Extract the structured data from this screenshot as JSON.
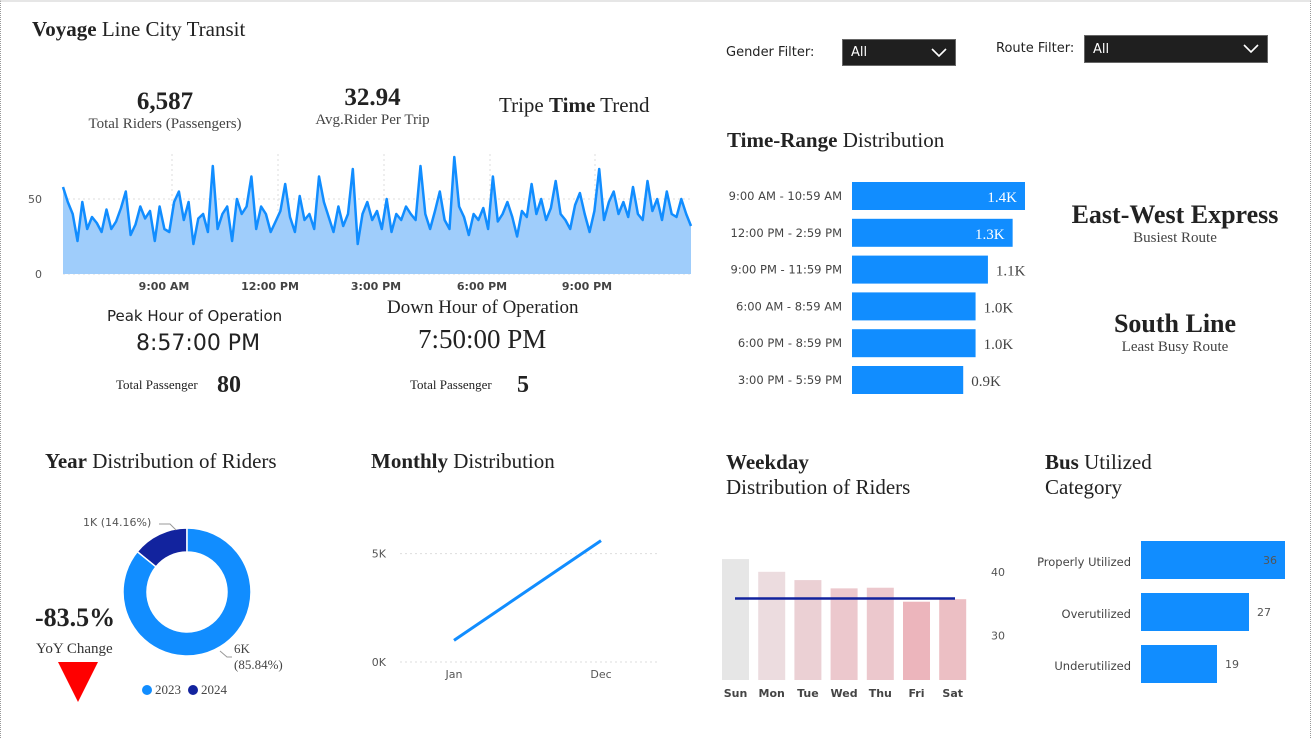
{
  "header": {
    "title_bold": "Voyage",
    "title_rest": " Line City Transit"
  },
  "filters": {
    "gender_label": "Gender Filter:",
    "gender_value": "All",
    "route_label": "Route Filter:",
    "route_value": "All"
  },
  "kpis": {
    "total_riders_value": "6,587",
    "total_riders_label": "Total Riders (Passengers)",
    "avg_rider_value": "32.94",
    "avg_rider_label": "Avg.Rider Per Trip"
  },
  "trend": {
    "title_a": "Tripe ",
    "title_b": "Time",
    "title_c": " Trend",
    "chart_data": {
      "type": "area",
      "title": "Tripe Time Trend",
      "x_ticks": [
        "9:00 AM",
        "12:00 PM",
        "3:00 PM",
        "6:00 PM",
        "9:00 PM"
      ],
      "y_ticks": [
        "0",
        "50"
      ],
      "ylim": [
        0,
        80
      ],
      "values": [
        58,
        48,
        40,
        22,
        48,
        30,
        38,
        34,
        28,
        43,
        30,
        35,
        44,
        55,
        26,
        33,
        45,
        37,
        42,
        22,
        45,
        30,
        28,
        48,
        55,
        36,
        48,
        20,
        37,
        40,
        28,
        72,
        30,
        40,
        45,
        22,
        50,
        40,
        45,
        65,
        30,
        45,
        40,
        28,
        35,
        42,
        60,
        38,
        28,
        52,
        36,
        40,
        30,
        65,
        48,
        38,
        28,
        45,
        32,
        40,
        70,
        20,
        40,
        48,
        36,
        42,
        30,
        50,
        28,
        40,
        36,
        45,
        40,
        36,
        72,
        40,
        30,
        42,
        55,
        36,
        30,
        78,
        45,
        38,
        26,
        40,
        36,
        44,
        30,
        65,
        35,
        40,
        48,
        38,
        25,
        42,
        38,
        60,
        40,
        50,
        36,
        44,
        62,
        40,
        36,
        30,
        46,
        54,
        40,
        28,
        42,
        70,
        36,
        48,
        55,
        40,
        48,
        38,
        58,
        40,
        36,
        62,
        42,
        50,
        36,
        55,
        40,
        38,
        50,
        40,
        32
      ]
    }
  },
  "peak": {
    "title": "Peak Hour of Operation",
    "time": "8:57:00 PM",
    "total_label": "Total Passenger",
    "total_value": "80"
  },
  "down": {
    "title": "Down Hour of Operation",
    "time": "7:50:00 PM",
    "total_label": "Total Passenger",
    "total_value": "5"
  },
  "time_range": {
    "title_bold": "Time-Range",
    "title_rest": "  Distribution",
    "bar_color": "#118dff",
    "chart_data": {
      "type": "bar",
      "orientation": "horizontal",
      "categories": [
        "9:00 AM - 10:59 AM",
        "12:00 PM - 2:59 PM",
        "9:00 PM - 11:59 PM",
        "6:00 AM - 8:59 AM",
        "6:00 PM - 8:59 PM",
        "3:00 PM - 5:59 PM"
      ],
      "values": [
        1400,
        1300,
        1100,
        1000,
        1000,
        900
      ],
      "value_labels": [
        "1.4K",
        "1.3K",
        "1.1K",
        "1.0K",
        "1.0K",
        "0.9K"
      ]
    }
  },
  "routes": {
    "busiest_name": "East-West Express",
    "busiest_label": "Busiest Route",
    "least_name": "South Line",
    "least_label": "Least Busy Route"
  },
  "year_dist": {
    "title_bold": "Year",
    "title_rest": " Distribution of Riders",
    "yoy_value": "-83.5%",
    "yoy_label": "YoY Change",
    "chart_data": {
      "type": "pie",
      "variant": "donut",
      "categories": [
        "2023",
        "2024"
      ],
      "values": [
        85.84,
        14.16
      ],
      "slice_labels": [
        "6K",
        "1K (14.16%)"
      ],
      "slice_label_pct_2023": "(85.84%)",
      "legend": [
        "2023",
        "2024"
      ],
      "colors": [
        "#118dff",
        "#12239e"
      ]
    }
  },
  "monthly": {
    "title_bold": "Monthly",
    "title_rest": " Distribution",
    "chart_data": {
      "type": "line",
      "categories": [
        "Jan",
        "Dec"
      ],
      "values": [
        1000,
        5600
      ],
      "y_ticks": [
        "0K",
        "5K"
      ],
      "ylim": [
        0,
        6000
      ],
      "color": "#118dff"
    }
  },
  "weekday": {
    "title_bold": "Weekday",
    "title_rest": "Distribution of Riders",
    "chart_data": {
      "type": "bar",
      "categories": [
        "Sun",
        "Mon",
        "Tue",
        "Wed",
        "Thu",
        "Fri",
        "Sat"
      ],
      "values": [
        42,
        40,
        38.7,
        37.4,
        37.5,
        35.3,
        35.7
      ],
      "average": 35.8,
      "y_ticks": [
        "30",
        "40"
      ],
      "ylim": [
        23,
        45
      ],
      "colors": [
        "#e6e6e6",
        "#ecdcdf",
        "#ebd0d4",
        "#ecc8cd",
        "#ecc8cd",
        "#ecb5bc",
        "#ecbfc4"
      ],
      "avg_color": "#12239e"
    }
  },
  "bus_util": {
    "title_bold": "Bus",
    "title_rest": " Utilized",
    "title_line2": "Category",
    "bar_color": "#118dff",
    "chart_data": {
      "type": "bar",
      "orientation": "horizontal",
      "categories": [
        "Properly Utilized",
        "Overutilized",
        "Underutilized"
      ],
      "values": [
        36,
        27,
        19
      ]
    }
  }
}
